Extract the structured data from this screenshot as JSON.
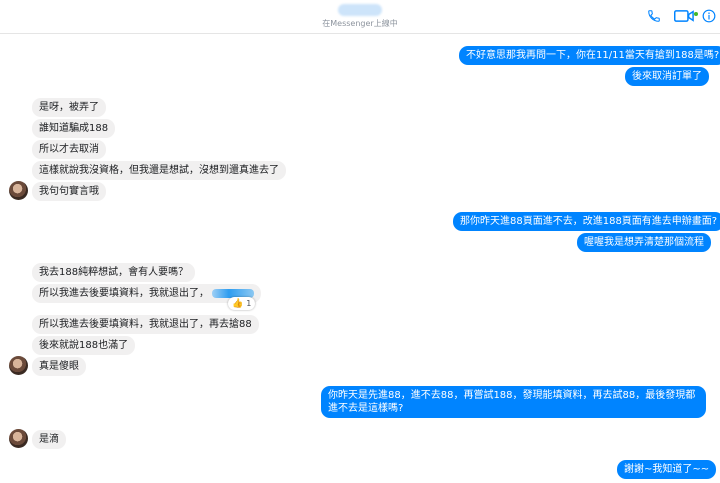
{
  "header": {
    "status": "在Messenger上線中",
    "icons": [
      "phone-icon",
      "video-icon",
      "info-icon"
    ],
    "accent_color": "#0084ff",
    "online_color": "#42b72a"
  },
  "messages": [
    {
      "text": "",
      "direction": "in"
    },
    {
      "text": "不好意思那我再問一下，你在11/11當天有搶到188是嗎?",
      "direction": "out"
    },
    {
      "text": "後來取消訂單了",
      "direction": "out"
    },
    {
      "text": "是呀，被弄了",
      "direction": "in"
    },
    {
      "text": "誰知道騙成188",
      "direction": "in"
    },
    {
      "text": "所以才去取消",
      "direction": "in"
    },
    {
      "text": "這樣就說我沒資格，但我還是想試，沒想到還真進去了",
      "direction": "in"
    },
    {
      "text": "我句句實言哦",
      "direction": "in"
    },
    {
      "text": "那你昨天進88頁面進不去，改進188頁面有進去申辦畫面?",
      "direction": "out"
    },
    {
      "text": "喔喔我是想弄清楚那個流程",
      "direction": "out"
    },
    {
      "text": "我去188純粹想試，會有人要嗎？",
      "direction": "in"
    },
    {
      "text": "所以我進去後要填資料，我就退出了，",
      "direction": "in",
      "reaction": {
        "icon": "thumbs-up-icon",
        "count": "1"
      }
    },
    {
      "text": "所以我進去後要填資料，我就退出了，再去搶88",
      "direction": "in"
    },
    {
      "text": "後來就說188也滿了",
      "direction": "in"
    },
    {
      "text": "真是傻眼",
      "direction": "in"
    },
    {
      "text": "你昨天是先進88，進不去88，再嘗試188，發現能填資料，再去試88，最後發現都進不去是這樣嗎?",
      "direction": "out"
    },
    {
      "text": "是滴",
      "direction": "in"
    },
    {
      "text": "謝謝~我知道了~~",
      "direction": "out"
    }
  ]
}
